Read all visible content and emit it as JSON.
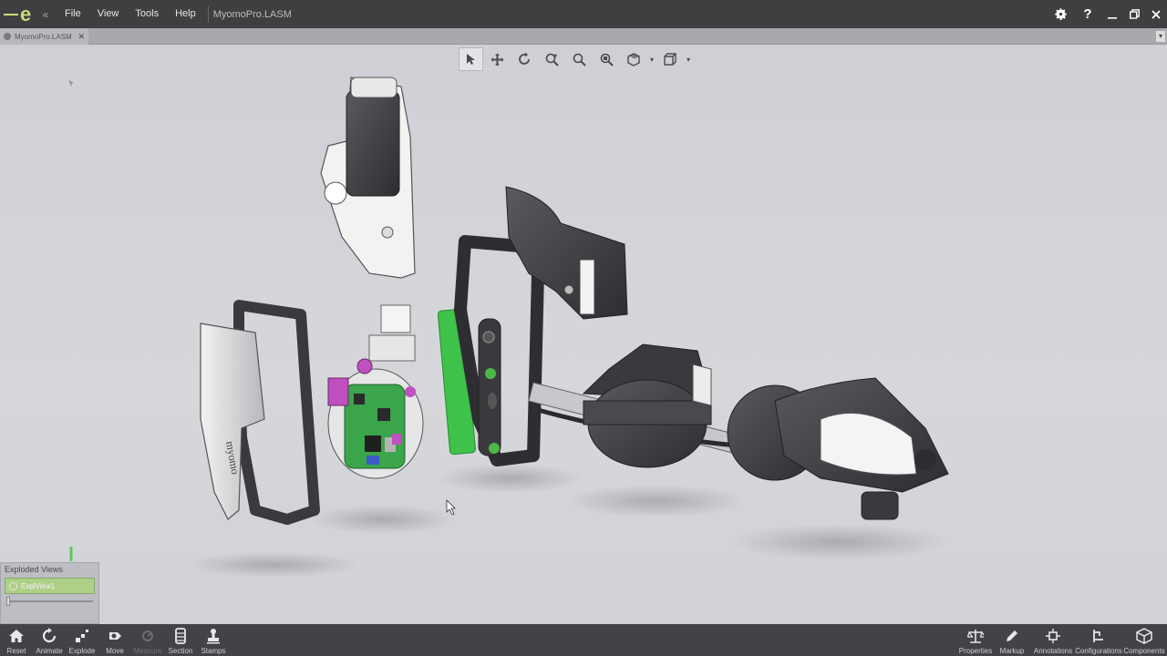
{
  "menu": {
    "items": [
      "File",
      "View",
      "Tools",
      "Help"
    ],
    "document_title": "MyomoPro.LASM"
  },
  "doc_tab": {
    "label": "MyomoPro.LASM"
  },
  "view_toolbar": {
    "tools": [
      "select-icon",
      "pan-icon",
      "rotate-icon",
      "zoom-icon",
      "zoom-area-icon",
      "zoom-fit-icon",
      "view-style-icon",
      "view-orientation-icon"
    ]
  },
  "exploded_views": {
    "title": "Exploded Views",
    "items": [
      "ExplView1"
    ],
    "slider_value": 0
  },
  "bottom_toolbar": {
    "left": [
      {
        "label": "Reset",
        "icon": "home-icon",
        "enabled": true
      },
      {
        "label": "Animate",
        "icon": "animate-icon",
        "enabled": true
      },
      {
        "label": "Explode",
        "icon": "explode-icon",
        "enabled": true
      },
      {
        "label": "Move",
        "icon": "move-icon",
        "enabled": true
      },
      {
        "label": "Measure",
        "icon": "measure-icon",
        "enabled": false
      },
      {
        "label": "Section",
        "icon": "section-icon",
        "enabled": true
      },
      {
        "label": "Stamps",
        "icon": "stamp-icon",
        "enabled": true
      }
    ],
    "right": [
      {
        "label": "Properties",
        "icon": "properties-icon"
      },
      {
        "label": "Markup",
        "icon": "pencil-icon"
      },
      {
        "label": "Annotations",
        "icon": "annotations-icon"
      },
      {
        "label": "Configurations",
        "icon": "configurations-icon"
      },
      {
        "label": "Components",
        "icon": "components-icon"
      }
    ]
  },
  "model": {
    "label_text": "myomo"
  },
  "colors": {
    "titlebar": "#3f3f41",
    "logo_accent": "#c8dc78",
    "pcb_green": "#3aa54a",
    "pcb_magenta": "#c04fc0"
  }
}
